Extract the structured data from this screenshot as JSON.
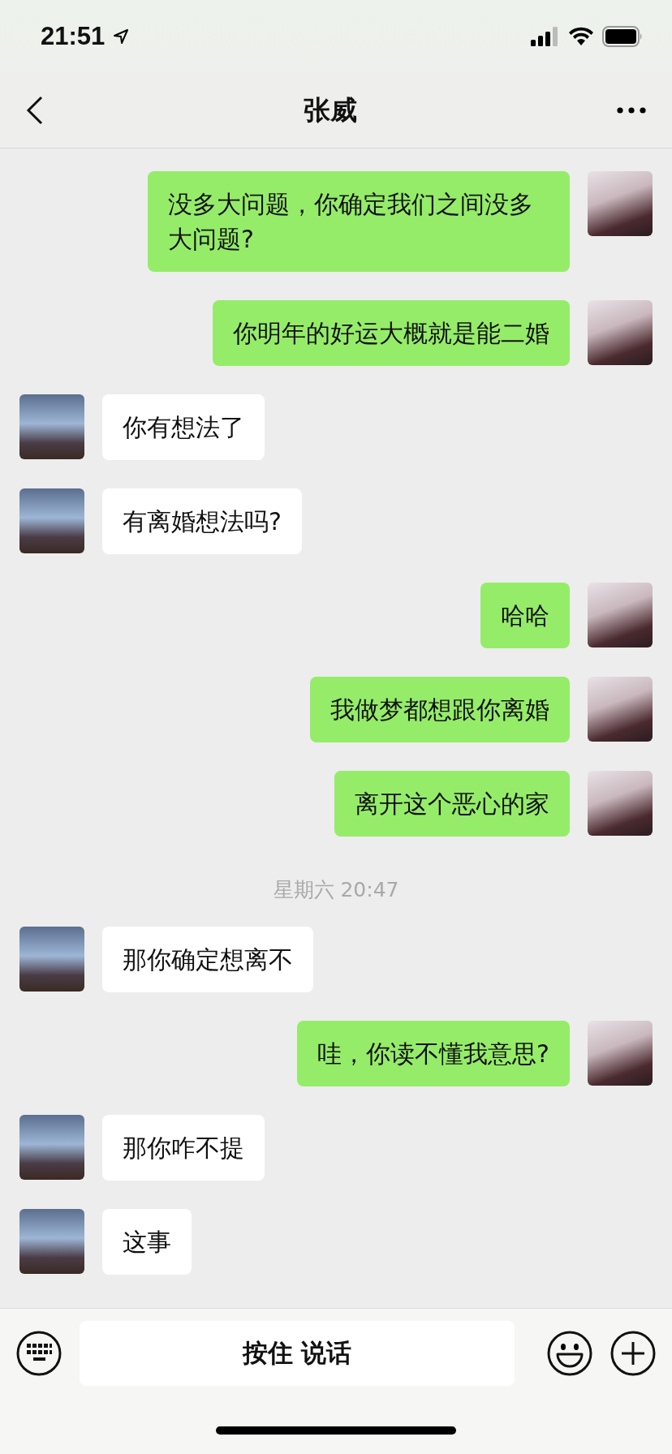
{
  "status_bar": {
    "time": "21:51"
  },
  "nav": {
    "title": "张威"
  },
  "messages": [
    {
      "kind": "message",
      "outgoing": true,
      "text": "没多大问题，你确定我们之间没多大问题?"
    },
    {
      "kind": "message",
      "outgoing": true,
      "text": "你明年的好运大概就是能二婚"
    },
    {
      "kind": "message",
      "outgoing": false,
      "text": "你有想法了"
    },
    {
      "kind": "message",
      "outgoing": false,
      "text": "有离婚想法吗?"
    },
    {
      "kind": "message",
      "outgoing": true,
      "text": "哈哈"
    },
    {
      "kind": "message",
      "outgoing": true,
      "text": "我做梦都想跟你离婚"
    },
    {
      "kind": "message",
      "outgoing": true,
      "text": "离开这个恶心的家"
    },
    {
      "kind": "time",
      "text": "星期六 20:47"
    },
    {
      "kind": "message",
      "outgoing": false,
      "text": "那你确定想离不"
    },
    {
      "kind": "message",
      "outgoing": true,
      "text": "哇，你读不懂我意思?"
    },
    {
      "kind": "message",
      "outgoing": false,
      "text": "那你咋不提"
    },
    {
      "kind": "message",
      "outgoing": false,
      "text": "这事"
    }
  ],
  "input_bar": {
    "voice_button": "按住 说话"
  }
}
